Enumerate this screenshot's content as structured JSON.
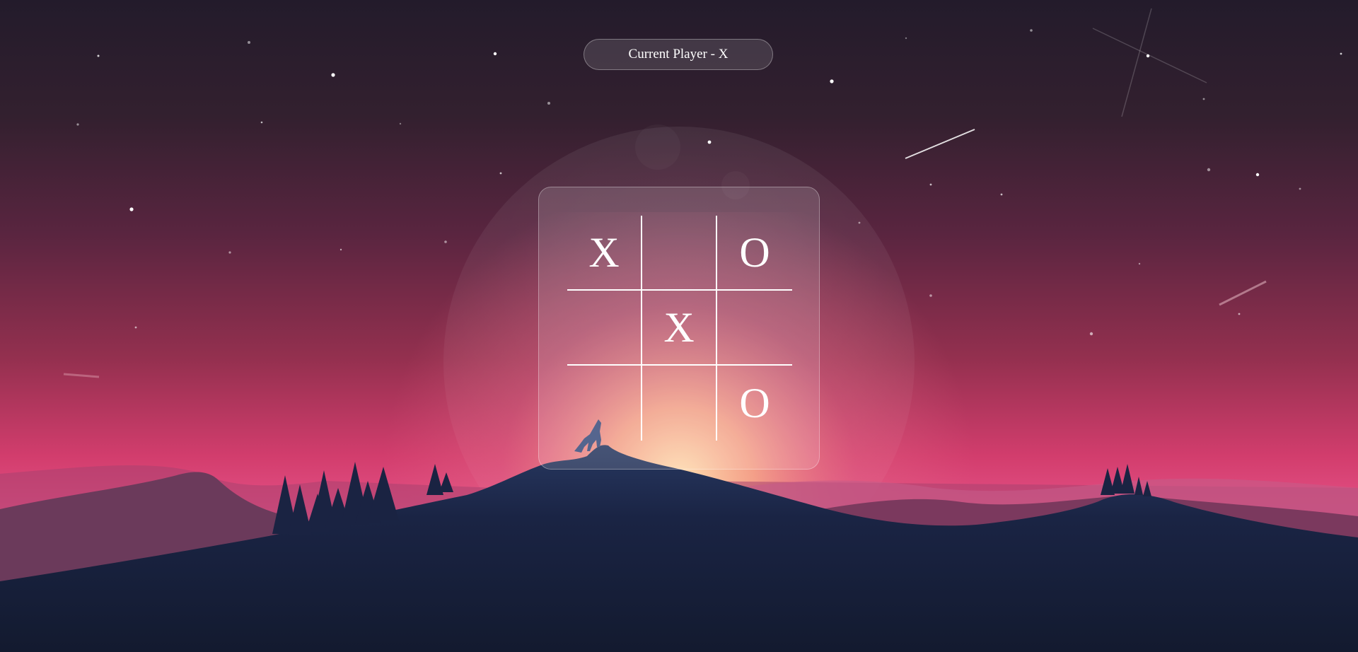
{
  "status": {
    "label": "Current Player - X"
  },
  "game": {
    "current_player": "X",
    "board": [
      [
        "X",
        "",
        "O"
      ],
      [
        "",
        "X",
        ""
      ],
      [
        "",
        "",
        "O"
      ]
    ]
  },
  "colors": {
    "sky_top": "#251c2c",
    "sky_mid": "#7a2d50",
    "horizon_pink": "#e0457a",
    "glow": "#f7b48a",
    "ground": "#141c32",
    "mark": "#ffffff"
  }
}
